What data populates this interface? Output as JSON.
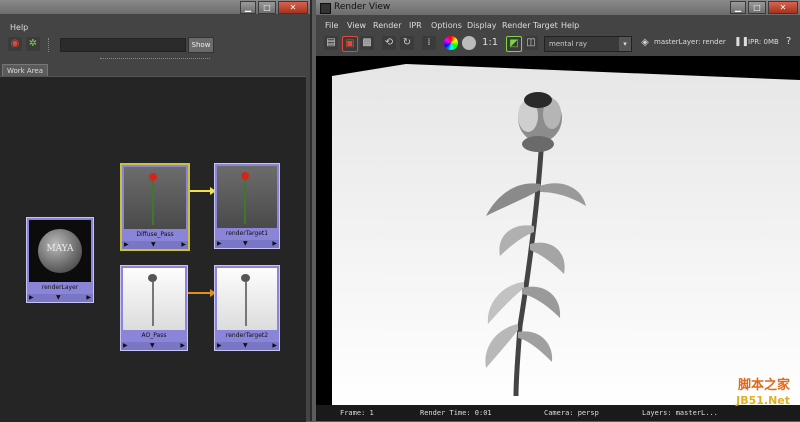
{
  "left_window": {
    "menu": {
      "help": "Help"
    },
    "toolbar": {
      "show_label": "Show",
      "search_value": ""
    },
    "tab": "Work Area",
    "nodes": {
      "render_layer": "renderLayer",
      "maya_logo": "MAYA",
      "diffuse_pass": "Diffuse_Pass",
      "target1": "renderTarget1",
      "ao_pass": "AO_Pass",
      "target2": "renderTarget2"
    }
  },
  "right_window": {
    "title": "Render View",
    "menu": [
      "File",
      "View",
      "Render",
      "IPR",
      "Options",
      "Display",
      "Render Target",
      "Help"
    ],
    "toolbar": {
      "ratio": "1:1",
      "renderer": "mental ray",
      "layer": "masterLayer: render",
      "ipr_memory": "IPR: 0MB"
    },
    "status": {
      "frame": "Frame: 1",
      "render_time": "Render Time: 0:01",
      "camera": "Camera: persp",
      "layers": "Layers: masterL..."
    }
  },
  "watermark": {
    "line1": "脚本之家",
    "line2": "JB51.Net"
  },
  "colors": {
    "node_fill": "#8a85d8",
    "link_yellow": "#f2e24a",
    "link_orange": "#e0901e",
    "selected_border": "#c9c23a"
  }
}
